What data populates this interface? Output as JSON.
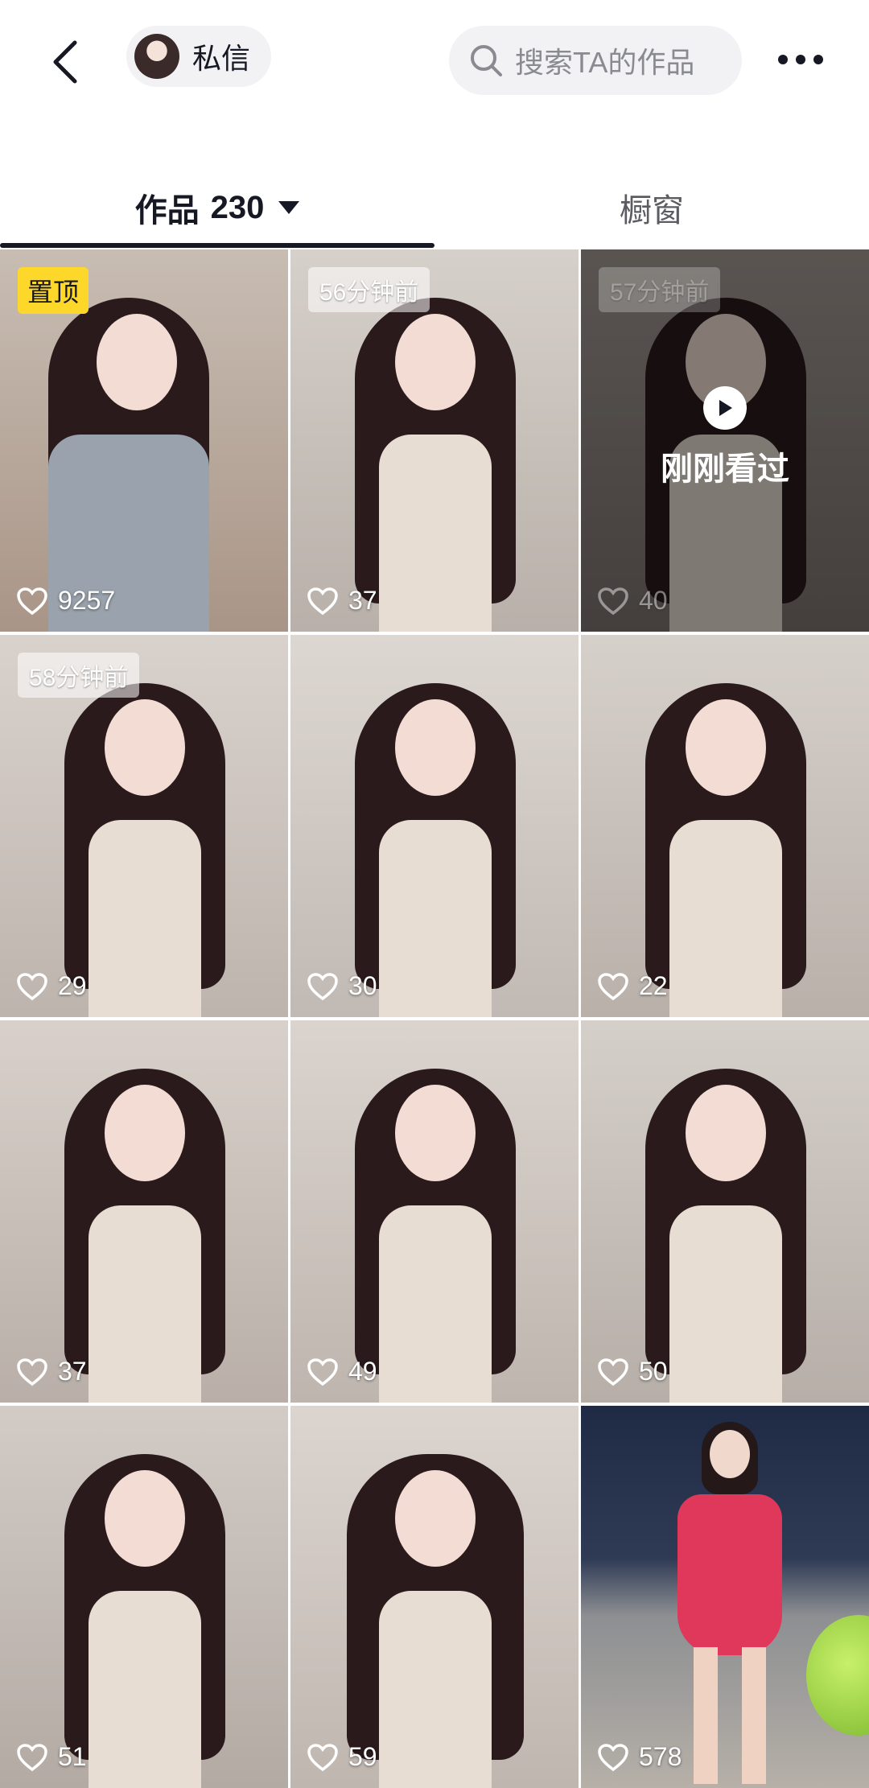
{
  "header": {
    "dm_label": "私信",
    "search_placeholder": "搜索TA的作品"
  },
  "tabs": {
    "works_label": "作品",
    "works_count": "230",
    "shop_label": "橱窗"
  },
  "videos": [
    {
      "likes": "9257",
      "badge": "置顶",
      "badge_type": "pinned",
      "bg": "#b9a79a"
    },
    {
      "likes": "37",
      "badge": "56分钟前",
      "badge_type": "time",
      "bg": "#c9c3bd"
    },
    {
      "likes": "40",
      "badge": "57分钟前",
      "badge_type": "time",
      "bg": "#8e8580",
      "watched_label": "刚刚看过"
    },
    {
      "likes": "29",
      "badge": "58分钟前",
      "badge_type": "time",
      "bg": "#cfc7c1"
    },
    {
      "likes": "30",
      "badge": "",
      "badge_type": "",
      "bg": "#d4cdc8"
    },
    {
      "likes": "22",
      "badge": "",
      "badge_type": "",
      "bg": "#cdc6c0"
    },
    {
      "likes": "37",
      "badge": "",
      "badge_type": "",
      "bg": "#cec6bf"
    },
    {
      "likes": "49",
      "badge": "",
      "badge_type": "",
      "bg": "#d1cac4"
    },
    {
      "likes": "50",
      "badge": "",
      "badge_type": "",
      "bg": "#cbc5bf"
    },
    {
      "likes": "51",
      "badge": "",
      "badge_type": "",
      "bg": "#c7c2bd"
    },
    {
      "likes": "59",
      "badge": "",
      "badge_type": "",
      "bg": "#d0c9c3"
    },
    {
      "likes": "578",
      "badge": "",
      "badge_type": "",
      "bg": "#2c3550"
    }
  ]
}
